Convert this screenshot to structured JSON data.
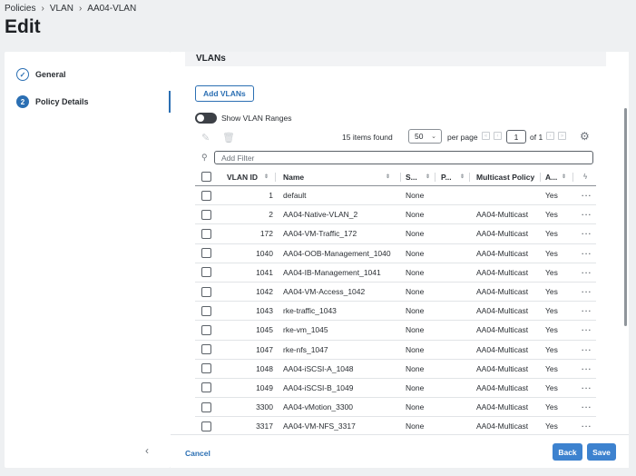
{
  "breadcrumb": [
    "Policies",
    "VLAN",
    "AA04-VLAN"
  ],
  "page_title": "Edit",
  "steps": [
    {
      "marker": "✓",
      "label": "General",
      "state": "done"
    },
    {
      "marker": "2",
      "label": "Policy Details",
      "state": "active"
    }
  ],
  "section_title": "VLANs",
  "add_button": "Add VLANs",
  "toggle_label": "Show VLAN Ranges",
  "toolbar": {
    "items_found": "15 items found",
    "per_page_value": "50",
    "per_page_label": "per page",
    "page_value": "1",
    "of_pages": "of 1"
  },
  "filter_placeholder": "Add Filter",
  "table": {
    "headers": {
      "vlan_id": "VLAN ID",
      "name": "Name",
      "s": "S...",
      "p": "P...",
      "multicast": "Multicast Policy",
      "a": "A..."
    },
    "rows": [
      {
        "id": "1",
        "name": "default",
        "s": "None",
        "mp": "",
        "a": "Yes"
      },
      {
        "id": "2",
        "name": "AA04-Native-VLAN_2",
        "s": "None",
        "mp": "AA04-Multicast",
        "a": "Yes"
      },
      {
        "id": "172",
        "name": "AA04-VM-Traffic_172",
        "s": "None",
        "mp": "AA04-Multicast",
        "a": "Yes"
      },
      {
        "id": "1040",
        "name": "AA04-OOB-Management_1040",
        "s": "None",
        "mp": "AA04-Multicast",
        "a": "Yes"
      },
      {
        "id": "1041",
        "name": "AA04-IB-Management_1041",
        "s": "None",
        "mp": "AA04-Multicast",
        "a": "Yes"
      },
      {
        "id": "1042",
        "name": "AA04-VM-Access_1042",
        "s": "None",
        "mp": "AA04-Multicast",
        "a": "Yes"
      },
      {
        "id": "1043",
        "name": "rke-traffic_1043",
        "s": "None",
        "mp": "AA04-Multicast",
        "a": "Yes"
      },
      {
        "id": "1045",
        "name": "rke-vm_1045",
        "s": "None",
        "mp": "AA04-Multicast",
        "a": "Yes"
      },
      {
        "id": "1047",
        "name": "rke-nfs_1047",
        "s": "None",
        "mp": "AA04-Multicast",
        "a": "Yes"
      },
      {
        "id": "1048",
        "name": "AA04-iSCSI-A_1048",
        "s": "None",
        "mp": "AA04-Multicast",
        "a": "Yes"
      },
      {
        "id": "1049",
        "name": "AA04-iSCSI-B_1049",
        "s": "None",
        "mp": "AA04-Multicast",
        "a": "Yes"
      },
      {
        "id": "3300",
        "name": "AA04-vMotion_3300",
        "s": "None",
        "mp": "AA04-Multicast",
        "a": "Yes"
      },
      {
        "id": "3317",
        "name": "AA04-VM-NFS_3317",
        "s": "None",
        "mp": "AA04-Multicast",
        "a": "Yes"
      }
    ]
  },
  "footer": {
    "cancel": "Cancel",
    "back": "Back",
    "save": "Save"
  },
  "colors": {
    "accent": "#2b6fb3",
    "primary_button": "#3d82cf"
  }
}
